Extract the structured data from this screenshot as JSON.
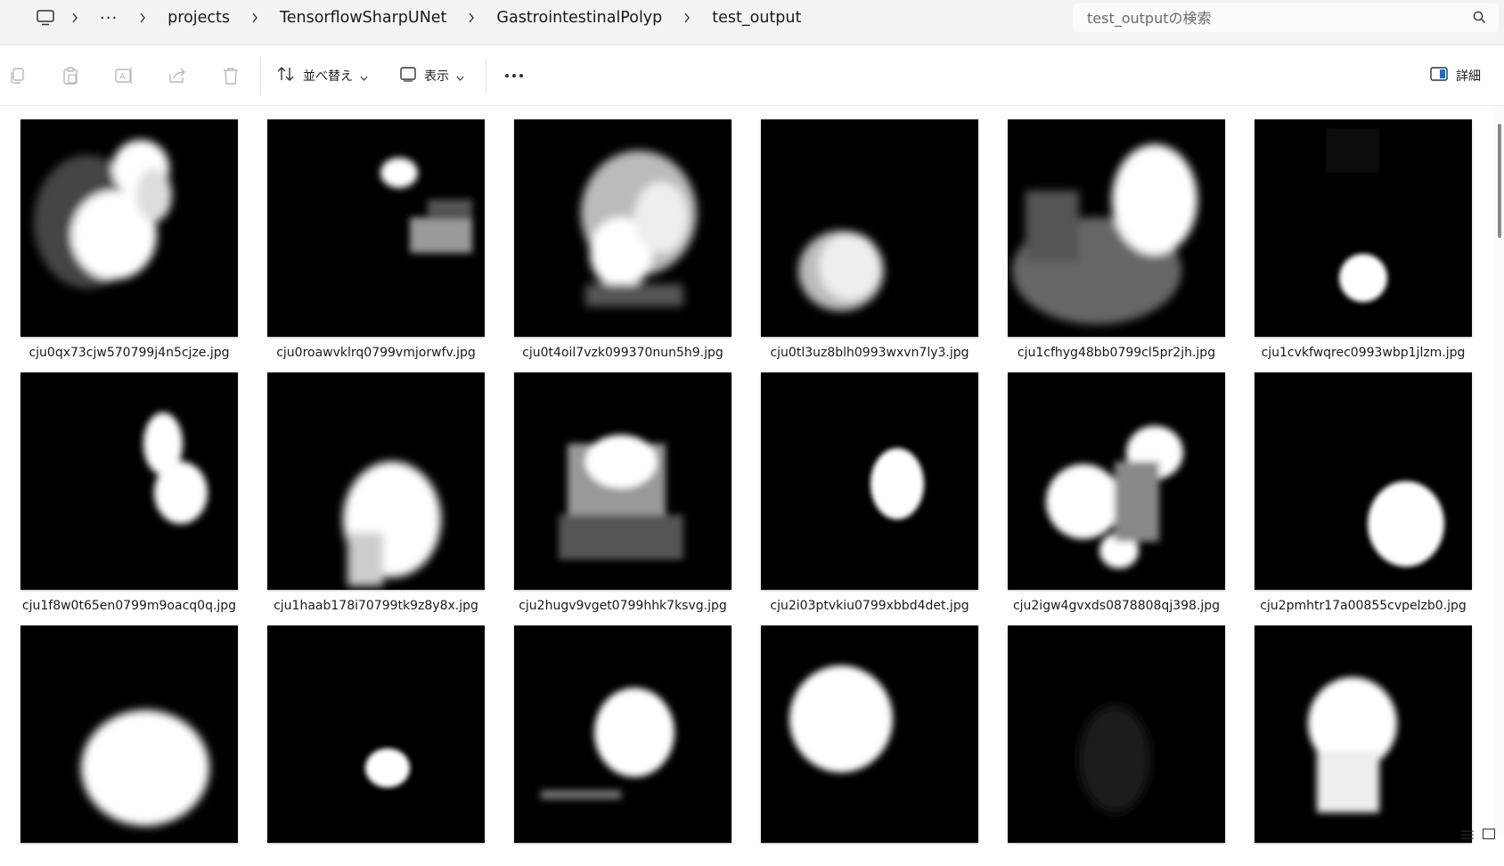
{
  "breadcrumb": {
    "overflow": "···",
    "segments": [
      "projects",
      "TensorflowSharpUNet",
      "GastrointestinalPolyp",
      "test_output"
    ]
  },
  "search": {
    "placeholder": "test_outputの検索"
  },
  "toolbar": {
    "sort_label": "並べ替え",
    "view_label": "表示",
    "details_label": "詳細",
    "icons": [
      "copy-icon",
      "paste-icon",
      "rename-icon",
      "share-icon",
      "delete-icon",
      "sort-icon",
      "view-icon",
      "more-icon",
      "details-pane-icon"
    ]
  },
  "files": [
    {
      "name": "cju0qx73cjw570799j4n5cjze.jpg"
    },
    {
      "name": "cju0roawvklrq0799vmjorwfv.jpg"
    },
    {
      "name": "cju0t4oil7vzk099370nun5h9.jpg"
    },
    {
      "name": "cju0tl3uz8blh0993wxvn7ly3.jpg"
    },
    {
      "name": "cju1cfhyg48bb0799cl5pr2jh.jpg"
    },
    {
      "name": "cju1cvkfwqrec0993wbp1jlzm.jpg"
    },
    {
      "name": "cju1f8w0t65en0799m9oacq0q.jpg"
    },
    {
      "name": "cju1haab178i70799tk9z8y8x.jpg"
    },
    {
      "name": "cju2hugv9vget0799hhk7ksvg.jpg"
    },
    {
      "name": "cju2i03ptvkiu0799xbbd4det.jpg"
    },
    {
      "name": "cju2igw4gvxds0878808qj398.jpg"
    },
    {
      "name": "cju2pmhtr17a00855cvpelzb0.jpg"
    },
    {
      "name": ""
    },
    {
      "name": ""
    },
    {
      "name": ""
    },
    {
      "name": ""
    },
    {
      "name": ""
    },
    {
      "name": ""
    }
  ],
  "colors": {
    "addressbar_bg": "#f3f3f3",
    "accent": "#1f6fc5"
  }
}
